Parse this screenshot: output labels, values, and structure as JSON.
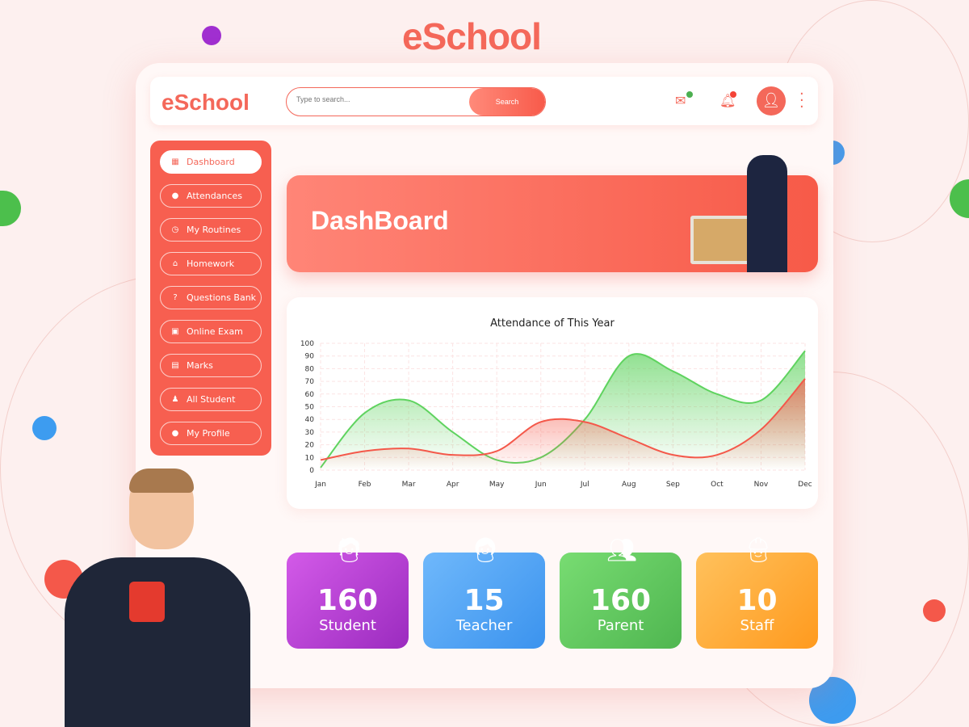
{
  "brand": "eSchool",
  "header": {
    "logo": "eSchool",
    "search_placeholder": "Type to search...",
    "search_button": "Search",
    "mail_dot_color": "#4caf50",
    "bell_dot_color": "#f44336"
  },
  "sidebar": {
    "items": [
      {
        "label": "Dashboard",
        "icon": "dashboard-icon",
        "active": true
      },
      {
        "label": "Attendances",
        "icon": "user-icon"
      },
      {
        "label": "My Routines",
        "icon": "clock-icon"
      },
      {
        "label": "Homework",
        "icon": "home-icon"
      },
      {
        "label": "Questions Bank",
        "icon": "question-icon"
      },
      {
        "label": "Online Exam",
        "icon": "monitor-icon"
      },
      {
        "label": "Marks",
        "icon": "clipboard-icon"
      },
      {
        "label": "All Student",
        "icon": "student-icon"
      },
      {
        "label": "My Profile",
        "icon": "profile-icon"
      }
    ]
  },
  "banner": {
    "title": "DashBoard"
  },
  "chart_data": {
    "type": "area",
    "title": "Attendance of This Year",
    "categories": [
      "Jan",
      "Feb",
      "Mar",
      "Apr",
      "May",
      "Jun",
      "Jul",
      "Aug",
      "Sep",
      "Oct",
      "Nov",
      "Dec"
    ],
    "yticks": [
      0,
      10,
      20,
      30,
      40,
      50,
      60,
      70,
      80,
      90,
      100
    ],
    "ylim": [
      0,
      100
    ],
    "grid": true,
    "series": [
      {
        "color": "#5fd35f",
        "values": [
          2,
          45,
          55,
          30,
          8,
          10,
          40,
          90,
          78,
          60,
          55,
          94
        ]
      },
      {
        "color": "#f4584a",
        "values": [
          8,
          15,
          17,
          12,
          15,
          38,
          38,
          25,
          12,
          12,
          32,
          72
        ]
      }
    ]
  },
  "stats": [
    {
      "value": "160",
      "label": "Student",
      "from": "#d35ae8",
      "to": "#9b2bbf"
    },
    {
      "value": "15",
      "label": "Teacher",
      "from": "#6fb8fb",
      "to": "#3b93ee"
    },
    {
      "value": "160",
      "label": "Parent",
      "from": "#78dc72",
      "to": "#4fb650"
    },
    {
      "value": "10",
      "label": "Staff",
      "from": "#ffc15c",
      "to": "#ff9a1e"
    }
  ]
}
